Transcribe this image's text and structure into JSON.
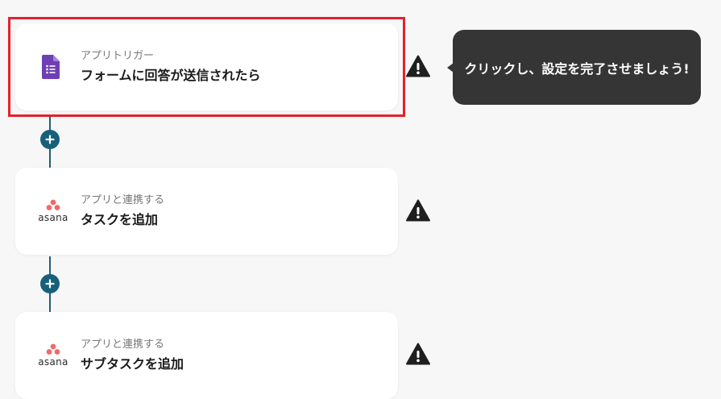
{
  "steps": [
    {
      "category": "アプリトリガー",
      "title": "フォームに回答が送信されたら",
      "app_icon": "google-forms-icon",
      "selected": true
    },
    {
      "category": "アプリと連携する",
      "title": "タスクを追加",
      "app_icon": "asana-icon",
      "app_name": "asana"
    },
    {
      "category": "アプリと連携する",
      "title": "サブタスクを追加",
      "app_icon": "asana-icon",
      "app_name": "asana"
    }
  ],
  "tooltip": {
    "text": "クリックし、設定を完了させましょう!"
  },
  "colors": {
    "background": "#f7f7f7",
    "connector": "#17607a",
    "selection_outline": "#e4222c",
    "tooltip_bg": "#353535",
    "forms_purple": "#6f3fb6",
    "asana_coral": "#f06a6a"
  },
  "icons": {
    "add": "plus-icon",
    "warning": "warning-triangle-icon"
  }
}
